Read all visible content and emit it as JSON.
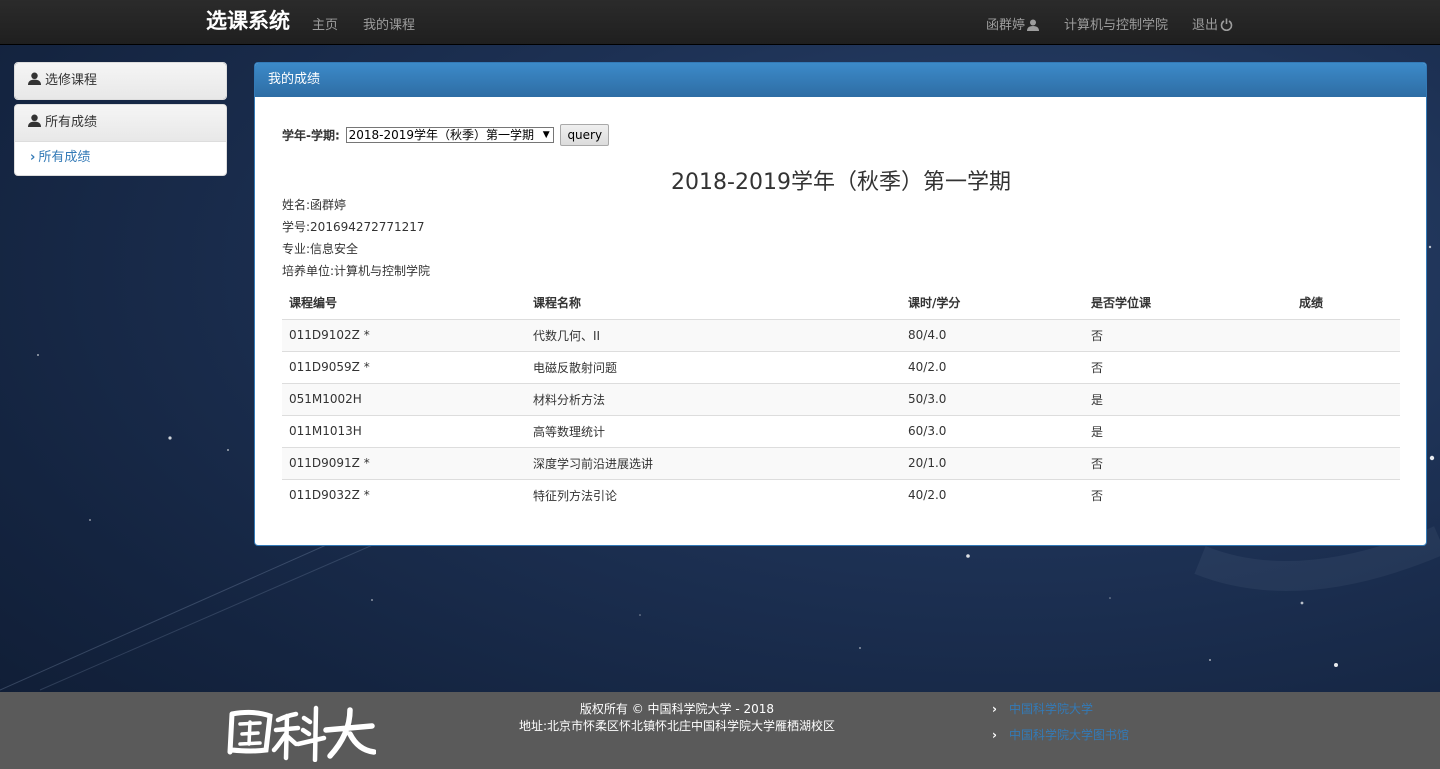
{
  "navbar": {
    "brand": "选课系统",
    "home": "主页",
    "my_courses": "我的课程",
    "user": "函群婷",
    "school": "计算机与控制学院",
    "logout": "退出"
  },
  "sidebar": {
    "elective": "选修课程",
    "all_grades_header": "所有成绩",
    "all_grades_link": "所有成绩"
  },
  "panel": {
    "title": "我的成绩",
    "filter_label": "学年-学期:",
    "selected_term": "2018-2019学年（秋季）第一学期",
    "query_button": "query",
    "term_title": "2018-2019学年（秋季）第一学期"
  },
  "student": {
    "name": "姓名:函群婷",
    "id": "学号:201694272771217",
    "major": "专业:信息安全",
    "unit": "培养单位:计算机与控制学院"
  },
  "table": {
    "headers": [
      "课程编号",
      "课程名称",
      "课时/学分",
      "是否学位课",
      "成绩"
    ],
    "rows": [
      [
        "011D9102Z *",
        "代数几何、II",
        "80/4.0",
        "否",
        ""
      ],
      [
        "011D9059Z *",
        "电磁反散射问题",
        "40/2.0",
        "否",
        ""
      ],
      [
        "051M1002H",
        "材料分析方法",
        "50/3.0",
        "是",
        ""
      ],
      [
        "011M1013H",
        "高等数理统计",
        "60/3.0",
        "是",
        ""
      ],
      [
        "011D9091Z *",
        "深度学习前沿进展选讲",
        "20/1.0",
        "否",
        ""
      ],
      [
        "011D9032Z *",
        "特征列方法引论",
        "40/2.0",
        "否",
        ""
      ]
    ]
  },
  "footer": {
    "logo_text": "国科大",
    "copyright": "版权所有 © 中国科学院大学 - 2018",
    "address": "地址:北京市怀柔区怀北镇怀北庄中国科学院大学雁栖湖校区",
    "link1": "中国科学院大学",
    "link2": "中国科学院大学图书馆"
  },
  "colors": {
    "accent": "#337ab7",
    "navbar": "#222222",
    "footer": "#5a5a5a"
  }
}
